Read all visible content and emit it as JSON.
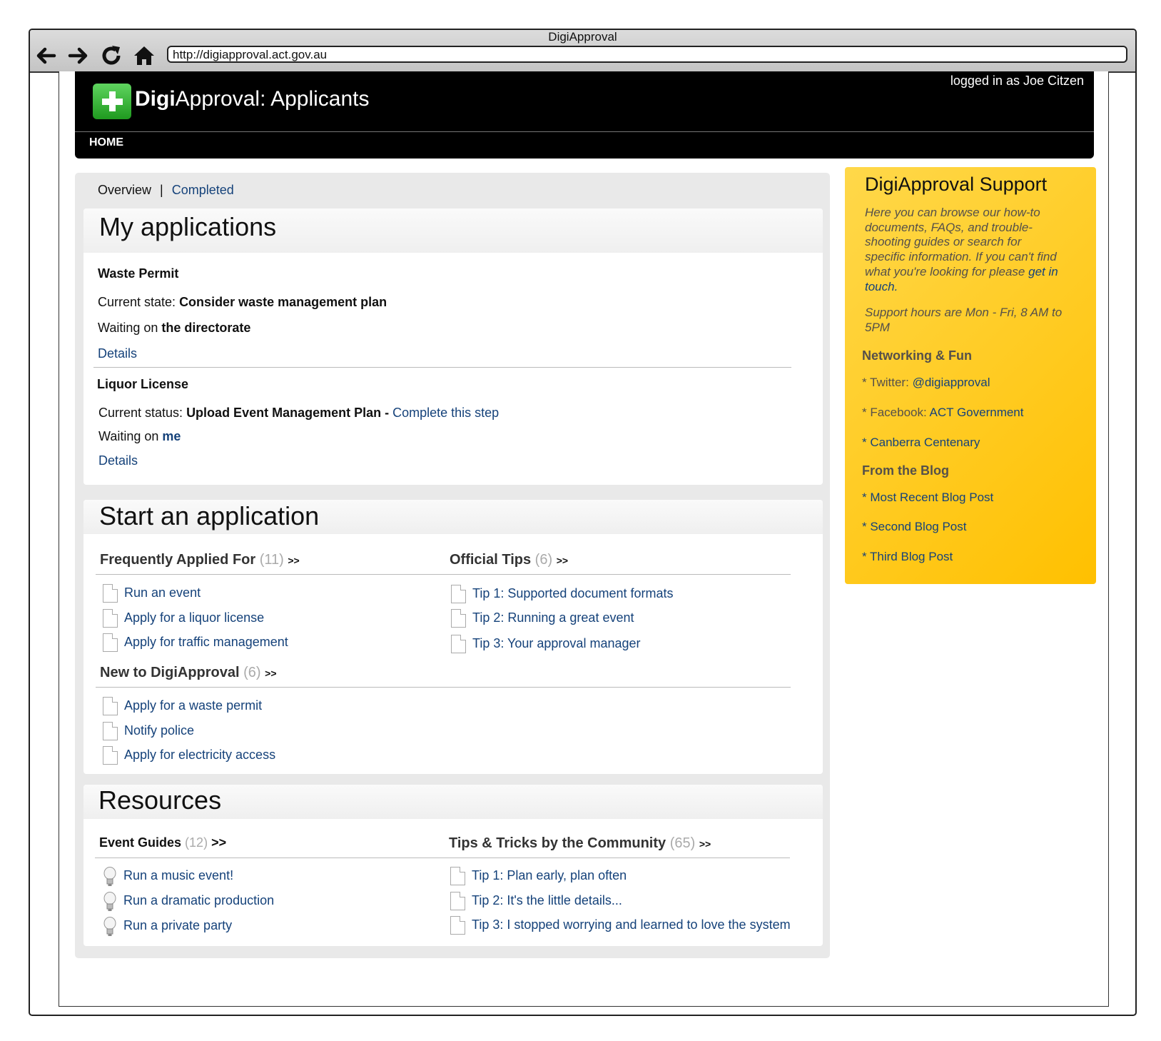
{
  "browser": {
    "title": "DigiApproval",
    "url": "http://digiapproval.act.gov.au"
  },
  "header": {
    "brand_bold": "Digi",
    "brand_rest": "Approval: Applicants",
    "login_text": "logged in as Joe Citzen",
    "nav_home": "HOME"
  },
  "tabs": {
    "overview": "Overview",
    "separator": "|",
    "completed": "Completed"
  },
  "my_applications": {
    "title": "My applications",
    "items": [
      {
        "name": "Waste Permit",
        "state_label": "Current state:",
        "state_value": "Consider waste management plan",
        "waiting_label": "Waiting on",
        "waiting_value": "the directorate",
        "details": "Details"
      },
      {
        "name": "Liquor License",
        "state_label": "Current status:",
        "state_value": "Upload Event Management Plan -",
        "action": "Complete this step",
        "waiting_label": "Waiting on",
        "waiting_value": "me",
        "details": "Details"
      }
    ]
  },
  "start_application": {
    "title": "Start an application",
    "frequent": {
      "heading": "Frequently Applied For",
      "count": "(11)",
      "more": ">>",
      "items": [
        "Run an event",
        "Apply for a liquor license",
        "Apply for traffic management"
      ]
    },
    "tips": {
      "heading": "Official Tips",
      "count": "(6)",
      "more": ">>",
      "items": [
        "Tip 1: Supported document formats",
        "Tip 2: Running a great event",
        "Tip 3: Your approval manager"
      ]
    },
    "new_to": {
      "heading": "New to DigiApproval",
      "count": "(6)",
      "more": ">>",
      "items": [
        "Apply for a waste permit",
        "Notify police",
        "Apply for electricity access"
      ]
    }
  },
  "resources": {
    "title": "Resources",
    "guides": {
      "heading": "Event Guides",
      "count": "(12)",
      "more": ">>",
      "items": [
        "Run a music event!",
        "Run a dramatic production",
        "Run a private party"
      ]
    },
    "community": {
      "heading": "Tips & Tricks by the Community",
      "count": "(65)",
      "more": ">>",
      "items": [
        "Tip 1: Plan early, plan often",
        "Tip 2: It's the little details...",
        "Tip 3: I stopped worrying and learned to love the system"
      ]
    }
  },
  "support": {
    "title": "DigiApproval Support",
    "description": "Here you can browse our how-to documents, FAQs, and trouble-shooting guides or search for specific information. If you can't find what you're looking for please",
    "contact_link": "get in touch.",
    "hours": "Support hours are Mon - Fri, 8 AM to 5PM",
    "networking_heading": "Networking & Fun",
    "twitter_label": "* Twitter:",
    "twitter_link": "@digiapproval",
    "facebook_label": "* Facebook:",
    "facebook_link": "ACT Government",
    "centenary_link": "* Canberra Centenary",
    "blog_heading": "From the Blog",
    "blog_posts": [
      "* Most Recent Blog Post",
      "* Second Blog Post",
      "* Third Blog Post"
    ]
  },
  "colors": {
    "link": "#15427a",
    "support_bg": "#ffc000",
    "header_bg": "#000000",
    "logo_green": "#2aa82a"
  }
}
